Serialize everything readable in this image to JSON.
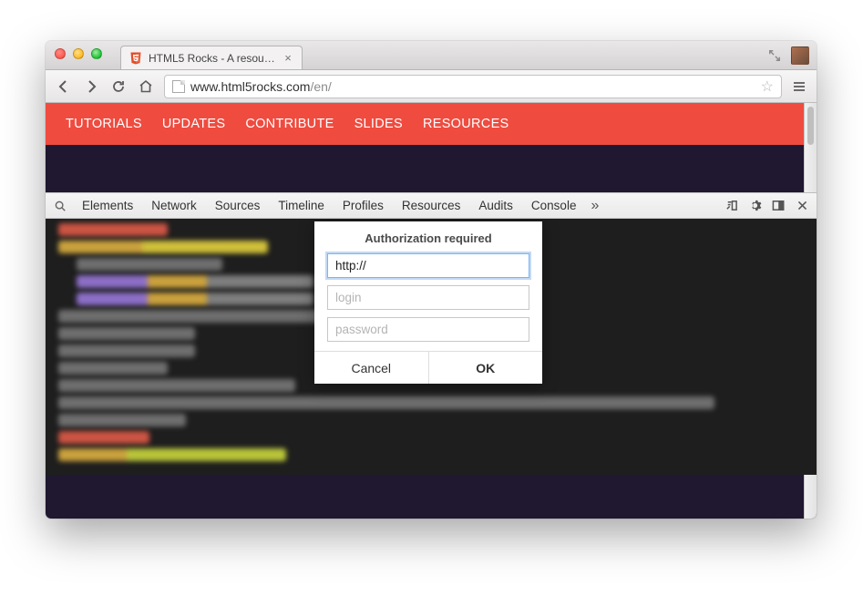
{
  "window": {
    "tab_title": "HTML5 Rocks - A resource",
    "url_host": "www.html5rocks.com",
    "url_path": "/en/"
  },
  "nav": {
    "items": [
      "TUTORIALS",
      "UPDATES",
      "CONTRIBUTE",
      "SLIDES",
      "RESOURCES"
    ]
  },
  "devtools": {
    "tabs": [
      "Elements",
      "Network",
      "Sources",
      "Timeline",
      "Profiles",
      "Resources",
      "Audits",
      "Console"
    ],
    "overflow": "»"
  },
  "dialog": {
    "title": "Authorization required",
    "url_value": "http://",
    "login_placeholder": "login",
    "password_placeholder": "password",
    "cancel": "Cancel",
    "ok": "OK"
  }
}
